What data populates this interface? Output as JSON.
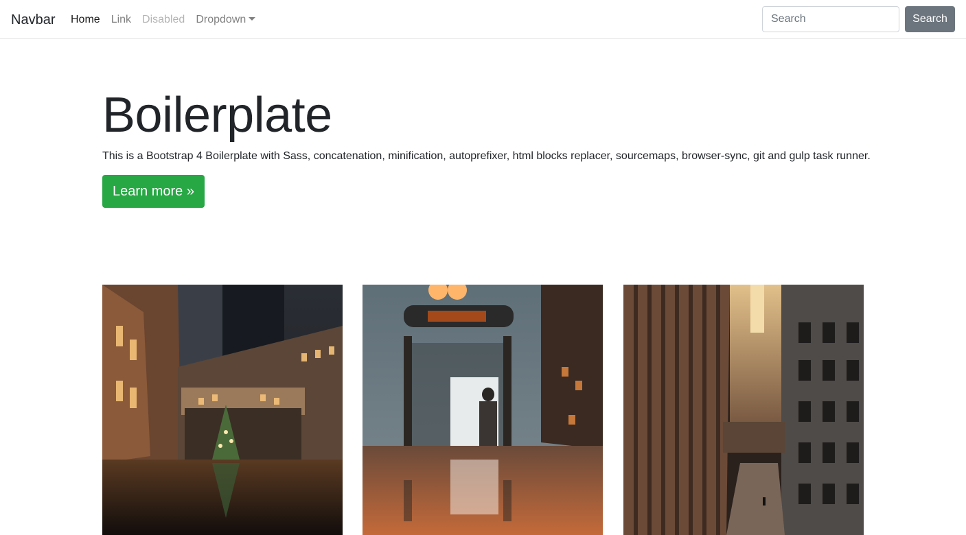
{
  "navbar": {
    "brand": "Navbar",
    "items": [
      {
        "label": "Home",
        "state": "active"
      },
      {
        "label": "Link",
        "state": "normal"
      },
      {
        "label": "Disabled",
        "state": "disabled"
      },
      {
        "label": "Dropdown",
        "state": "dropdown"
      }
    ],
    "search_placeholder": "Search",
    "search_button": "Search"
  },
  "hero": {
    "title": "Boilerplate",
    "lead": "This is a Bootstrap 4 Boilerplate with Sass, concatenation, minification, autoprefixer, html blocks replacer, sourcemaps, browser-sync, git and gulp task runner.",
    "button": "Learn more »"
  },
  "photos": [
    {
      "icon": "city-night-street-photo"
    },
    {
      "icon": "bus-stop-night-photo"
    },
    {
      "icon": "city-alley-buildings-photo"
    }
  ],
  "colors": {
    "primary_button": "#28a745",
    "secondary_button": "#6c757d",
    "text": "#212529"
  }
}
